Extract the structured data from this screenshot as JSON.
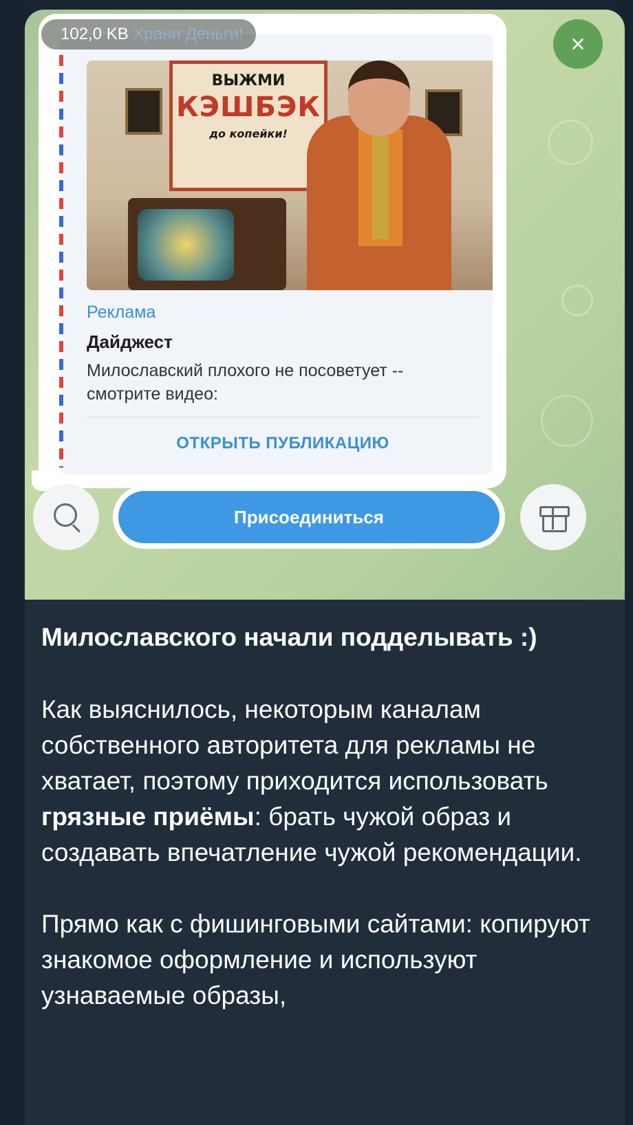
{
  "media": {
    "size_badge": "102,0 KB",
    "size_badge_ghost": "Храни Деньги!",
    "close_label": "×"
  },
  "ad_card": {
    "poster": {
      "line1": "ВЫЖМИ",
      "line2": "КЭШБЭК",
      "line3": "до копейки!"
    },
    "label": "Реклама",
    "title": "Дайджест",
    "description": "Милославский плохого не посоветует -- смотрите видео:",
    "open_button": "ОТКРЫТЬ ПУБЛИКАЦИЮ"
  },
  "bottom_bar": {
    "join_button": "Присоединиться",
    "search_icon": "search-icon",
    "gift_icon": "gift-icon"
  },
  "post": {
    "title": "Милославского начали подделывать :)",
    "para1_a": "Как выяснилось, некоторым каналам собственного авторитета для рекламы не хватает, поэтому приходится использовать ",
    "para1_bold": "грязные приёмы",
    "para1_b": ": брать чужой образ и создавать впечатление чужой рекомендации.",
    "para2": "Прямо как с фишинговыми сайтами: копируют знакомое оформление и используют узнаваемые образы,"
  },
  "colors": {
    "accent": "#3e98e4",
    "link": "#3a8fd8",
    "close": "#5fa257",
    "post_bg": "#212d3b"
  }
}
